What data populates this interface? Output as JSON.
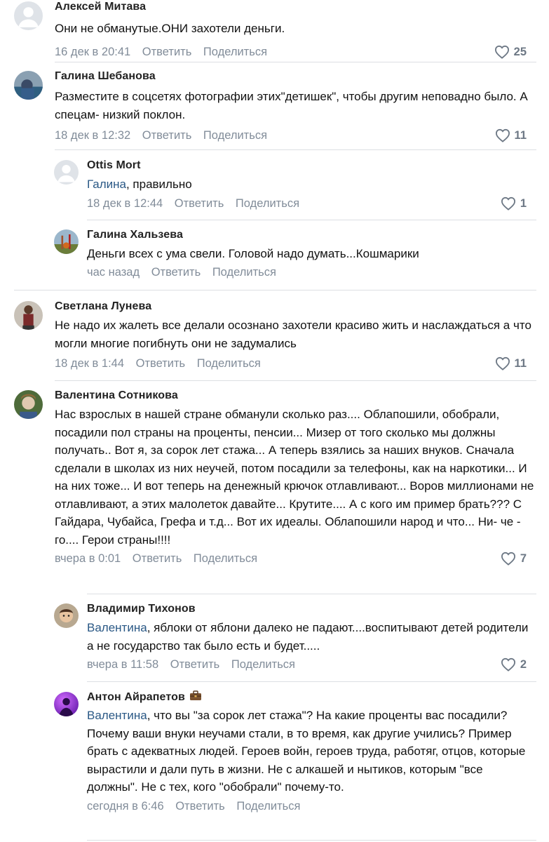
{
  "comments": [
    {
      "author": "Алексей Митава",
      "text": "Они не обманутые.ОНИ захотели деньги.",
      "time": "16 дек в 20:41",
      "reply_label": "Ответить",
      "share_label": "Поделиться",
      "likes": "25"
    },
    {
      "author": "Галина Шебанова",
      "text": "Разместите в соцсетях фотографии этих\"детишек\", чтобы другим неповадно было. А спецам- низкий поклон.",
      "time": "18 дек в 12:32",
      "reply_label": "Ответить",
      "share_label": "Поделиться",
      "likes": "11"
    },
    {
      "author": "Ottis Mort",
      "mention": "Галина",
      "text": ", правильно",
      "time": "18 дек в 12:44",
      "reply_label": "Ответить",
      "share_label": "Поделиться",
      "likes": "1"
    },
    {
      "author": "Галина Хальзева",
      "text": "Деньги всех с ума свели. Головой надо думать...Кошмарики",
      "time": "час назад",
      "reply_label": "Ответить",
      "share_label": "Поделиться"
    },
    {
      "author": "Светлана Лунева",
      "text": "Не надо их жалеть все делали осознано захотели красиво жить и наслаждаться а что могли многие погибнуть они не задумались",
      "time": "18 дек в 1:44",
      "reply_label": "Ответить",
      "share_label": "Поделиться",
      "likes": "11"
    },
    {
      "author": "Валентина Сотникова",
      "text": "Нас взрослых в нашей стране обманули сколько раз.... Облапошили, обобрали, посадили пол страны на проценты, пенсии... Мизер от того сколько мы должны получать.. Вот я, за сорок лет стажа... А теперь взялись за наших внуков. Сначала сделали в школах из них неучей, потом посадили за телефоны, как на наркотики... И на них тоже... И вот теперь на денежный крючок отлавливают... Воров миллионами не отлавливают, а этих малолеток давайте... Крутите.... А с кого им пример брать??? С Гайдара, Чубайса, Грефа и т.д... Вот их идеалы. Облапошили народ и что... Ни- че - го.... Герои страны!!!!",
      "time": "вчера в 0:01",
      "reply_label": "Ответить",
      "share_label": "Поделиться",
      "likes": "7"
    },
    {
      "author": "Владимир Тихонов",
      "mention": "Валентина",
      "text": ", яблоки от яблони далеко не падают....воспитывают детей родители а не государство так было есть и будет.....",
      "time": "вчера в 11:58",
      "reply_label": "Ответить",
      "share_label": "Поделиться",
      "likes": "2"
    },
    {
      "author": "Антон Айрапетов",
      "mention": "Валентина",
      "text": ", что вы \"за сорок лет стажа\"? На какие проценты вас посадили?\nПочему ваши внуки неучами стали, в то время, как другие учились? Пример брать с адекватных людей. Героев войн, героев труда, работяг, отцов, которые вырастили и дали путь в жизни. Не с алкашей и нытиков, которым \"все должны\". Не с тех, кого \"обобрали\" почему-то.",
      "time": "сегодня в 6:46",
      "reply_label": "Ответить",
      "share_label": "Поделиться"
    }
  ],
  "colors": {
    "meta": "#818c99",
    "mention": "#2a5885",
    "divider": "#dcdfe3"
  }
}
